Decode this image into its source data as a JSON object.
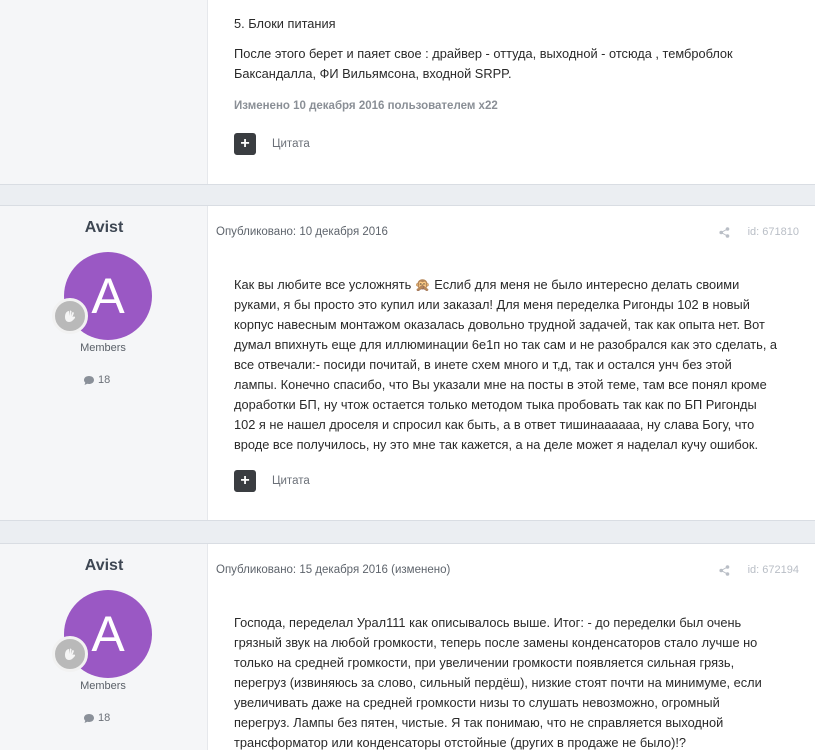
{
  "post_top": {
    "list_item": "5. Блоки питания",
    "paragraph": "После этого берет и паяет свое : драйвер - оттуда, выходной - отсюда , темброблок Баксандалла, ФИ Вильямсона, входной SRPP.",
    "edited_note": "Изменено 10 декабря 2016 пользователем x22",
    "quote_label": "Цитата",
    "plus_label": "+"
  },
  "post_2": {
    "author": "Avist",
    "avatar_letter": "A",
    "avatar_color": "#9a58c4",
    "group": "Members",
    "post_count": "18",
    "date": "Опубликовано: 10 декабря 2016",
    "post_id": "id: 671810",
    "lines": [
      "Как вы любите все усложнять 🙊 Еслиб для меня не было интересно делать своими",
      "руками, я бы просто это купил или заказал! Для меня переделка Ригонды 102 в новый",
      "корпус навесным монтажом оказалась довольно трудной задачей, так как опыта нет. Вот",
      "думал впихнуть еще для иллюминации 6е1п но так сам и не разобрался как это сделать, а",
      "все отвечали:- посиди почитай, в инете схем много и т,д, так и остался унч без этой",
      "лампы. Конечно спасибо, что Вы указали мне на посты в этой теме, там все понял кроме",
      "доработки БП, ну чтож остается только методом тыка пробовать так как по БП Ригонды",
      "102 я не нашел дроселя и спросил как быть, а в ответ тишинаааааа, ну слава Богу, что",
      "вроде все получилось, ну это мне так кажется, а на деле может я наделал кучу ошибок."
    ],
    "quote_label": "Цитата",
    "plus_label": "+"
  },
  "post_3": {
    "author": "Avist",
    "avatar_letter": "A",
    "avatar_color": "#9a58c4",
    "group": "Members",
    "post_count": "18",
    "date": "Опубликовано: 15 декабря 2016 (изменено)",
    "post_id": "id: 672194",
    "lines": [
      "Господа, переделал Урал111 как описывалось выше. Итог: - до переделки был очень",
      "грязный звук на любой громкости, теперь после замены конденсаторов стало лучше но",
      "только на средней громкости, при увеличении громкости появляется сильная грязь,",
      "перегруз (извиняюсь за слово, сильный пердёш), низкие стоят почти на минимуме, если",
      "увеличивать даже на средней громкости низы то слушать невозможно, огромный",
      "перегруз. Лампы без пятен, чистые. Я так понимаю, что не справляется выходной",
      "трансформатор или конденсаторы отстойные (других в продаже не было)!?"
    ]
  }
}
